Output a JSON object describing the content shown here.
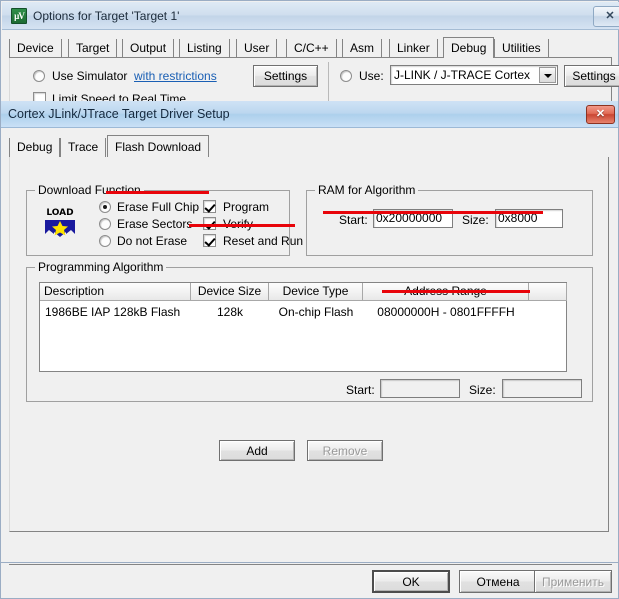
{
  "outer_dialog": {
    "title": "Options for Target 'Target 1'",
    "icon": "uvision-icon",
    "icon_text": "µV",
    "close_label": "✕",
    "tabs": [
      {
        "label": "Device",
        "selected": false
      },
      {
        "label": "Target",
        "selected": false
      },
      {
        "label": "Output",
        "selected": false
      },
      {
        "label": "Listing",
        "selected": false
      },
      {
        "label": "User",
        "selected": false
      },
      {
        "label": "C/C++",
        "selected": false
      },
      {
        "label": "Asm",
        "selected": false
      },
      {
        "label": "Linker",
        "selected": false
      },
      {
        "label": "Debug",
        "selected": true
      },
      {
        "label": "Utilities",
        "selected": false
      }
    ],
    "debug_page": {
      "use_simulator_label": "Use Simulator",
      "with_restrictions_link": "with restrictions",
      "limit_speed_label": "Limit Speed to Real Time",
      "simulator_settings_label": "Settings",
      "use_label": "Use:",
      "driver_value": "J-LINK / J-TRACE Cortex",
      "driver_settings_label": "Settings"
    },
    "footer": {
      "ok_label": "OK",
      "cancel_label": "Отмена",
      "apply_label": "Применить"
    }
  },
  "inner_dialog": {
    "title": "Cortex JLink/JTrace Target Driver Setup",
    "close_label": "✕",
    "tabs": [
      {
        "label": "Debug",
        "selected": false
      },
      {
        "label": "Trace",
        "selected": false
      },
      {
        "label": "Flash Download",
        "selected": true
      }
    ],
    "download_function": {
      "group_title": "Download Function",
      "icon_label": "LOAD",
      "erase_options": [
        {
          "label": "Erase Full Chip",
          "selected": true
        },
        {
          "label": "Erase Sectors",
          "selected": false
        },
        {
          "label": "Do not Erase",
          "selected": false
        }
      ],
      "checkboxes": [
        {
          "label": "Program",
          "checked": true
        },
        {
          "label": "Verify",
          "checked": true
        },
        {
          "label": "Reset and Run",
          "checked": true
        }
      ]
    },
    "ram_for_algorithm": {
      "group_title": "RAM for Algorithm",
      "start_label": "Start:",
      "start_value": "0x20000000",
      "size_label": "Size:",
      "size_value": "0x8000"
    },
    "programming_algorithm": {
      "group_title": "Programming Algorithm",
      "columns": [
        "Description",
        "Device Size",
        "Device Type",
        "Address Range",
        ""
      ],
      "rows": [
        {
          "description": "1986BE IAP 128kB Flash",
          "device_size": "128k",
          "device_type": "On-chip Flash",
          "address_range": "08000000H - 0801FFFFH"
        }
      ],
      "start_label": "Start:",
      "start_value": "",
      "size_label": "Size:",
      "size_value": "",
      "add_label": "Add",
      "remove_label": "Remove"
    }
  },
  "annotations": {
    "highlight_color": "#e8040a",
    "underlined_items": [
      "Erase Full Chip",
      "Reset and Run",
      "RAM Start/Size row",
      "08000000H - 0801FFFFH"
    ]
  }
}
